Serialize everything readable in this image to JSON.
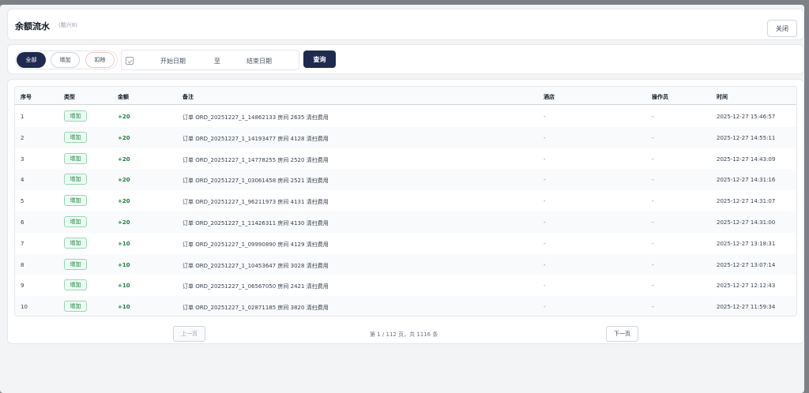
{
  "header": {
    "title": "余额流水",
    "subtitle": "(酷兴8)",
    "close_label": "关闭"
  },
  "filters": {
    "segments": [
      "全部",
      "增加",
      "扣除"
    ],
    "active_segment": "全部",
    "date_start_placeholder": "开始日期",
    "date_separator": "至",
    "date_end_placeholder": "结束日期",
    "query_label": "查询"
  },
  "table": {
    "columns": [
      "序号",
      "类型",
      "金额",
      "备注",
      "酒店",
      "操作员",
      "时间"
    ],
    "rows": [
      {
        "idx": "1",
        "type": "增加",
        "amount": "+20",
        "note": "订单 ORD_20251227_1_14862133 房间 2635 清扫费用",
        "hotel": "-",
        "operator": "-",
        "time": "2025-12-27 15:46:57"
      },
      {
        "idx": "2",
        "type": "增加",
        "amount": "+20",
        "note": "订单 ORD_20251227_1_14193477 房间 4128 清扫费用",
        "hotel": "-",
        "operator": "-",
        "time": "2025-12-27 14:55:11"
      },
      {
        "idx": "3",
        "type": "增加",
        "amount": "+20",
        "note": "订单 ORD_20251227_1_14778255 房间 2520 清扫费用",
        "hotel": "-",
        "operator": "-",
        "time": "2025-12-27 14:43:09"
      },
      {
        "idx": "4",
        "type": "增加",
        "amount": "+20",
        "note": "订单 ORD_20251227_1_03061458 房间 2521 清扫费用",
        "hotel": "-",
        "operator": "-",
        "time": "2025-12-27 14:31:16"
      },
      {
        "idx": "5",
        "type": "增加",
        "amount": "+20",
        "note": "订单 ORD_20251227_1_96211973 房间 4131 清扫费用",
        "hotel": "-",
        "operator": "-",
        "time": "2025-12-27 14:31:07"
      },
      {
        "idx": "6",
        "type": "增加",
        "amount": "+20",
        "note": "订单 ORD_20251227_1_11426311 房间 4130 清扫费用",
        "hotel": "-",
        "operator": "-",
        "time": "2025-12-27 14:31:00"
      },
      {
        "idx": "7",
        "type": "增加",
        "amount": "+10",
        "note": "订单 ORD_20251227_1_09990890 房间 4129 清扫费用",
        "hotel": "-",
        "operator": "-",
        "time": "2025-12-27 13:18:31"
      },
      {
        "idx": "8",
        "type": "增加",
        "amount": "+10",
        "note": "订单 ORD_20251227_1_10453647 房间 3028 清扫费用",
        "hotel": "-",
        "operator": "-",
        "time": "2025-12-27 13:07:14"
      },
      {
        "idx": "9",
        "type": "增加",
        "amount": "+10",
        "note": "订单 ORD_20251227_1_06567050 房间 2421 清扫费用",
        "hotel": "-",
        "operator": "-",
        "time": "2025-12-27 12:12:43"
      },
      {
        "idx": "10",
        "type": "增加",
        "amount": "+10",
        "note": "订单 ORD_20251227_1_02871185 房间 3820 清扫费用",
        "hotel": "-",
        "operator": "-",
        "time": "2025-12-27 11:59:34"
      }
    ]
  },
  "pagination": {
    "prev_label": "上一页",
    "info": "第 1 / 112 页，共 1116 条",
    "next_label": "下一页"
  },
  "colors": {
    "primary": "#1e2a4f",
    "success": "#15803d"
  }
}
